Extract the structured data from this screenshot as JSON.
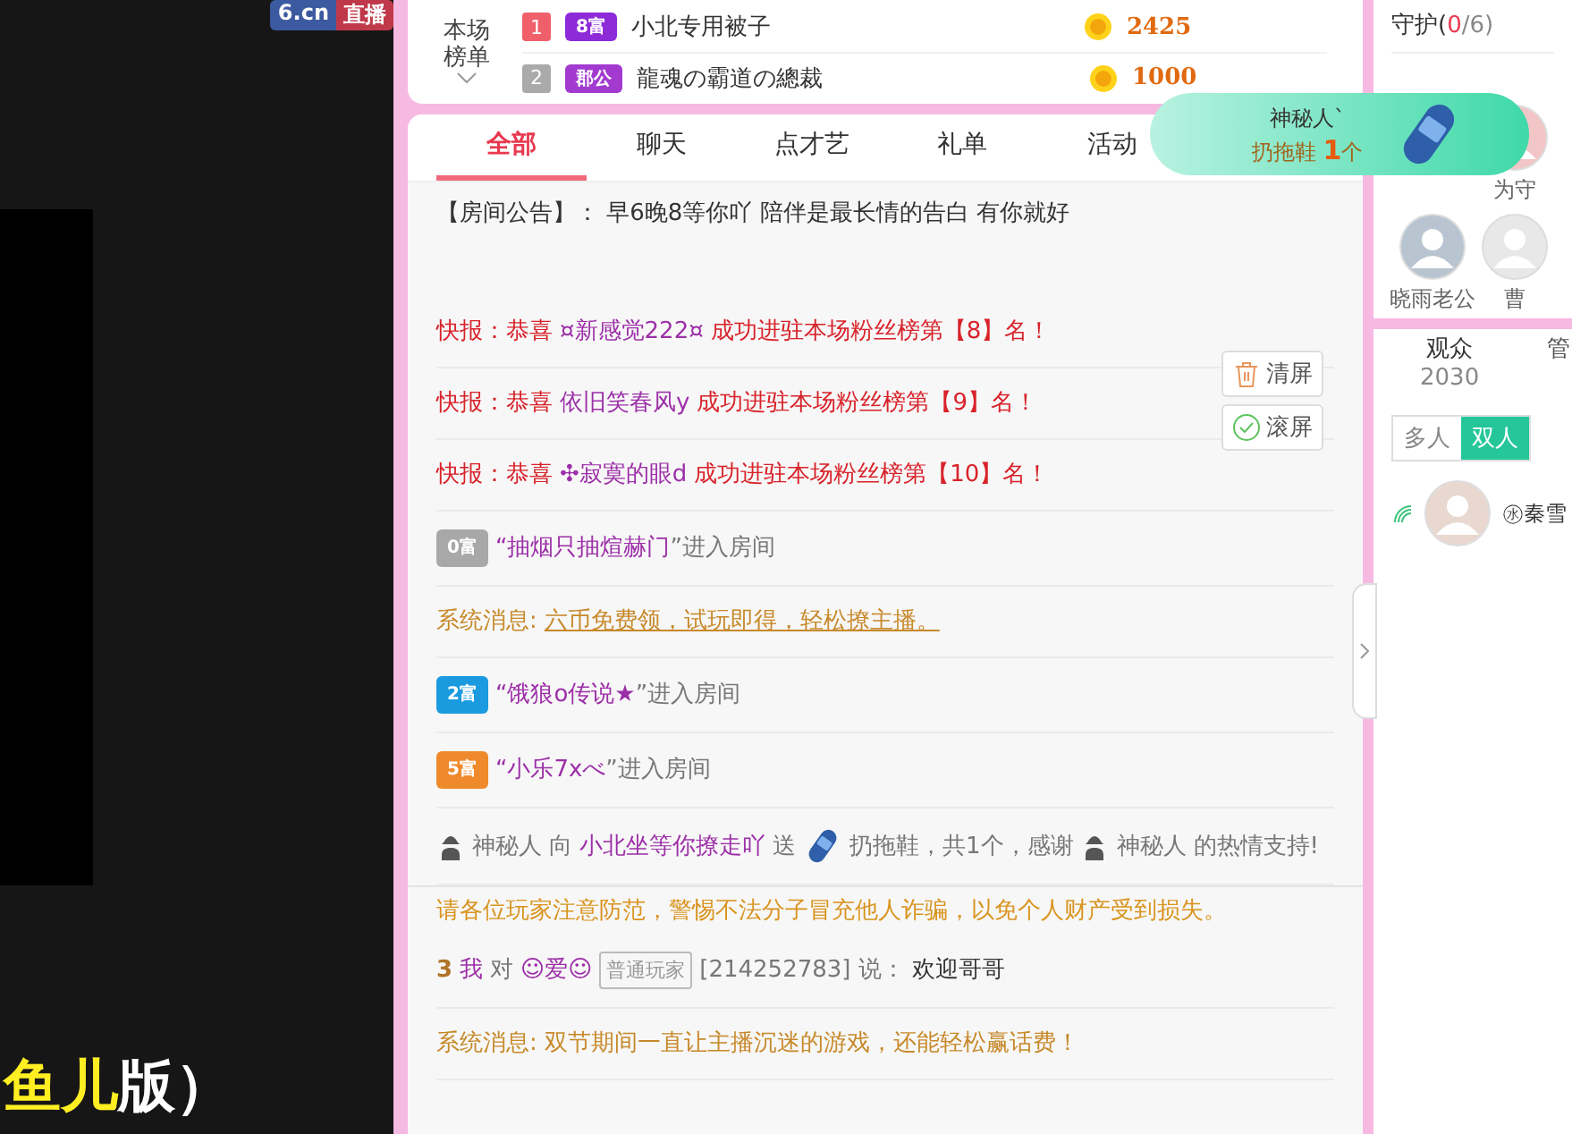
{
  "player": {
    "logo": "6.cn",
    "logo_tag": "直播",
    "caption_highlight": "鱼儿",
    "caption": "版）"
  },
  "ranking": {
    "title": "本场榜单",
    "rows": [
      {
        "rank": "1",
        "badge": "8富",
        "color": "#8e2bd8",
        "name": "小北专用被子",
        "coins": "2425"
      },
      {
        "rank": "2",
        "badge": "郡公",
        "color": "#a23ad0",
        "name": "龍魂の霸道の總裁",
        "coins": "1000"
      }
    ]
  },
  "gift_popup": {
    "sender": "神秘人`",
    "action": "扔拖鞋",
    "count": "1",
    "unit": "个"
  },
  "chat": {
    "tabs": [
      {
        "label": "全部",
        "selected": true
      },
      {
        "label": "聊天",
        "selected": false
      },
      {
        "label": "点才艺",
        "selected": false
      },
      {
        "label": "礼单",
        "selected": false
      },
      {
        "label": "活动",
        "selected": false
      }
    ],
    "announcement": "【房间公告】： 早6晚8等你吖 陪伴是最长情的告白 有你就好",
    "messages": [
      {
        "kind": "flash",
        "prefix": "快报：恭喜",
        "user": "¤新感觉222¤",
        "text": "成功进驻本场粉丝榜第【8】名！"
      },
      {
        "kind": "flash",
        "prefix": "快报：恭喜",
        "user": "依旧笑春风y",
        "text": "成功进驻本场粉丝榜第【9】名！"
      },
      {
        "kind": "flash",
        "prefix": "快报：恭喜",
        "user": "✣寂寞的眼d",
        "text": "成功进驻本场粉丝榜第【10】名！"
      },
      {
        "kind": "enter",
        "badge": "0富",
        "color": "#a8a8a8",
        "user": "“抽烟只抽煊赫门",
        "text": "”进入房间"
      },
      {
        "kind": "system",
        "label": "系统消息:",
        "text": "六币免费领，试玩即得，轻松撩主播。",
        "link": true
      },
      {
        "kind": "enter",
        "badge": "2富",
        "color": "#1a9be0",
        "user": "“饿狼o传说★",
        "text": "”进入房间"
      },
      {
        "kind": "enter",
        "badge": "5富",
        "color": "#ee8a2c",
        "user": "“小乐7xべ",
        "text": "”进入房间"
      },
      {
        "kind": "gift",
        "sender": "神秘人",
        "to": "向",
        "target": "小北坐等你撩走吖",
        "send": "送",
        "gift": "扔拖鞋，共1个，感谢",
        "sender2": "神秘人",
        "end": "的热情支持!"
      },
      {
        "kind": "warning",
        "text": "请各位玩家注意防范，警惕不法分子冒充他人诈骗，以免个人财产受到损失。"
      },
      {
        "kind": "chat",
        "level": "3",
        "user": "我",
        "to": "对",
        "target": "☺爱☺",
        "role": "普通玩家",
        "id": "[214252783]",
        "said": "说：",
        "text": "欢迎哥哥"
      },
      {
        "kind": "system",
        "label": "系统消息:",
        "text": "双节期间一直让主播沉迷的游戏，还能轻松赢话费！",
        "link": false
      }
    ],
    "controls": [
      {
        "kind": "clear",
        "label": "清屏"
      },
      {
        "kind": "scroll",
        "label": "滚屏"
      }
    ]
  },
  "side": {
    "guard": {
      "label": "守护(",
      "count": "0",
      "rest": "/6)"
    },
    "guardians": [
      {
        "name": "为守"
      },
      {
        "name": "晓雨老公"
      },
      {
        "name": "曹"
      }
    ],
    "audience_tabs": [
      {
        "label": "观众",
        "count": "2030",
        "selected": true
      },
      {
        "label": "管",
        "selected": false
      }
    ],
    "modes": [
      {
        "label": "多人",
        "selected": false
      },
      {
        "label": "双人",
        "selected": true
      }
    ],
    "viewers": [
      {
        "name": "㊌秦雪"
      }
    ]
  }
}
